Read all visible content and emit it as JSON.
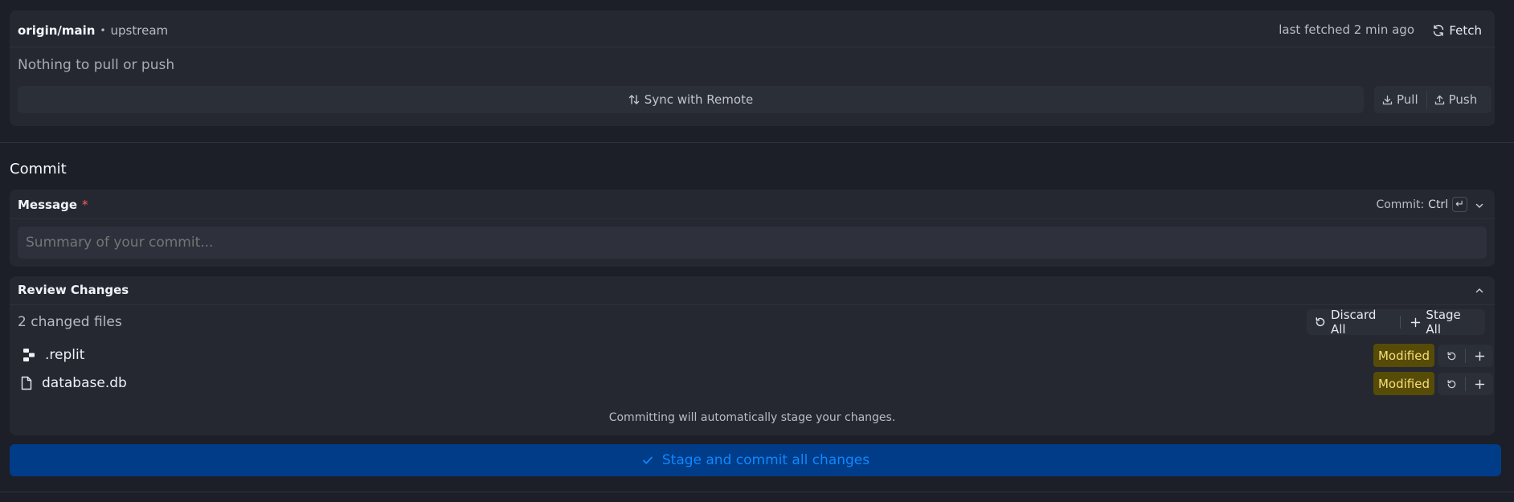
{
  "remote": {
    "branch": "origin/main",
    "separator": "•",
    "tracking": "upstream",
    "last_fetched": "last fetched 2 min ago",
    "fetch_label": "Fetch",
    "status": "Nothing to pull or push",
    "sync_label": "Sync with Remote",
    "pull_label": "Pull",
    "push_label": "Push"
  },
  "commit": {
    "section_title": "Commit",
    "message_label": "Message",
    "required_mark": "*",
    "shortcut_label": "Commit:",
    "shortcut_key": "Ctrl",
    "shortcut_enter": "↵",
    "placeholder": "Summary of your commit..."
  },
  "review": {
    "title": "Review Changes",
    "changed_count": "2 changed files",
    "discard_all": "Discard All",
    "stage_all": "Stage All",
    "files": [
      {
        "name": ".replit",
        "status": "Modified",
        "icon": "replit-icon"
      },
      {
        "name": "database.db",
        "status": "Modified",
        "icon": "file-icon"
      }
    ],
    "note": "Committing will automatically stage your changes."
  },
  "primary_action": {
    "label": "Stage and commit all changes"
  },
  "colors": {
    "background": "#1c1f27",
    "card": "#252831",
    "accent_button": "#003c87",
    "accent_text": "#0f87ff",
    "modified_badge_bg": "#574b08",
    "modified_badge_text": "#f7df77",
    "required": "#ff5b5b"
  }
}
